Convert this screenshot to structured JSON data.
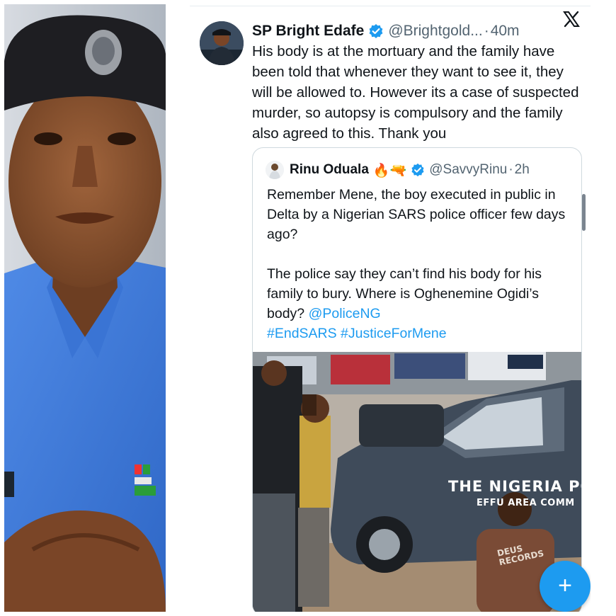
{
  "portrait": {
    "alt": "Police officer portrait"
  },
  "tweet": {
    "author_name": "SP Bright Edafe",
    "author_handle": "@Brightgold...",
    "separator": "·",
    "time": "40m",
    "text": "His body is at the mortuary and the family have been told that whenever they want to see it, they will be allowed to. However its a case of suspected murder, so autopsy is compulsory and the family also agreed to this. Thank you"
  },
  "quote": {
    "author_name": "Rinu Oduala",
    "emojis": "🔥🔫",
    "author_handle": "@SavvyRinu",
    "separator": "·",
    "time": "2h",
    "paragraph1": "Remember Mene, the boy executed in public in Delta by a Nigerian SARS police officer few days ago?",
    "paragraph2_text": "The police say they can’t find his body for his family to bury. Where is Oghenemine Ogidi’s body? ",
    "mention": "@PoliceNG",
    "hashtags": "#EndSARS #JusticeForMene",
    "media": {
      "van_text_line1": "THE NIGERIA POL",
      "van_text_line2": "EFFU    AREA COMM",
      "shirt_text": "DEUS\nRECORDS"
    }
  },
  "compose_label": "+",
  "colors": {
    "accent": "#1d9bf0",
    "text": "#0f1419",
    "secondary_text": "#536471",
    "border": "#cfd9de"
  },
  "icons": [
    "verified-badge-icon",
    "x-logo-icon",
    "compose-plus-icon"
  ]
}
